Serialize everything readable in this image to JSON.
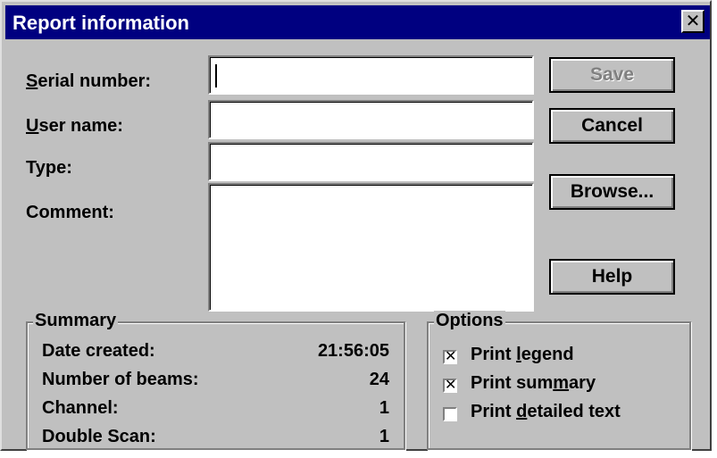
{
  "window": {
    "title": "Report information",
    "close_glyph": "✕"
  },
  "form": {
    "serial": {
      "label_accel": "S",
      "label_rest": "erial number:",
      "value": ""
    },
    "user": {
      "label_accel": "U",
      "label_rest": "ser name:",
      "value": ""
    },
    "type": {
      "label": "Type:",
      "value": ""
    },
    "comment": {
      "label": "Comment:",
      "value": ""
    }
  },
  "buttons": {
    "save": "Save",
    "cancel": "Cancel",
    "browse": "Browse...",
    "help": "Help"
  },
  "summary": {
    "title": "Summary",
    "rows": [
      {
        "label": "Date created:",
        "value": "21:56:05"
      },
      {
        "label": "Number of beams:",
        "value": "24"
      },
      {
        "label": "Channel:",
        "value": "1"
      },
      {
        "label": "Double Scan:",
        "value": "1"
      }
    ]
  },
  "options": {
    "title": "Options",
    "items": [
      {
        "pre": "Print ",
        "accel": "l",
        "post": "egend",
        "checked": true
      },
      {
        "pre": "Print sum",
        "accel": "m",
        "post": "ary",
        "checked": true
      },
      {
        "pre": "Print ",
        "accel": "d",
        "post": "etailed text",
        "checked": false
      }
    ],
    "check_glyph": "✕"
  }
}
